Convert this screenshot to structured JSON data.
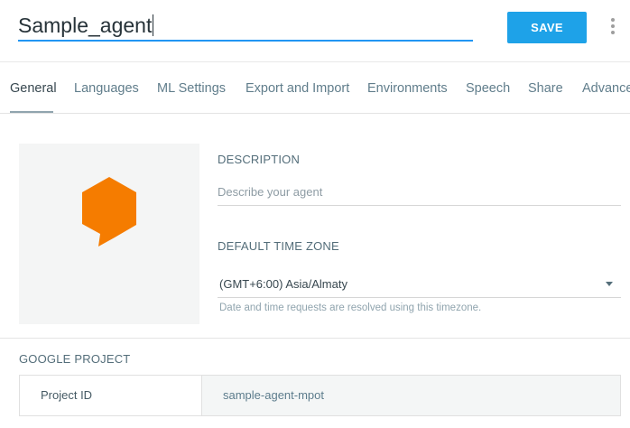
{
  "header": {
    "agent_name": "Sample_agent",
    "save_label": "SAVE"
  },
  "tabs": [
    {
      "label": "General",
      "active": true
    },
    {
      "label": "Languages"
    },
    {
      "label": "ML Settings"
    },
    {
      "label": "Export and Import"
    },
    {
      "label": "Environments"
    },
    {
      "label": "Speech"
    },
    {
      "label": "Share"
    },
    {
      "label": "Advanced"
    }
  ],
  "general": {
    "description_label": "DESCRIPTION",
    "description_placeholder": "Describe your agent",
    "timezone_label": "DEFAULT TIME ZONE",
    "timezone_value": "(GMT+6:00) Asia/Almaty",
    "timezone_hint": "Date and time requests are resolved using this timezone."
  },
  "google_project": {
    "label": "GOOGLE PROJECT",
    "key": "Project ID",
    "value": "sample-agent-mpot"
  },
  "colors": {
    "accent": "#1ea2e8",
    "avatar": "#f57c00",
    "underline": "#2196f3"
  },
  "icons": {
    "avatar": "agent-bubble-icon",
    "more": "more-vert-icon",
    "dropdown": "caret-down-icon"
  }
}
